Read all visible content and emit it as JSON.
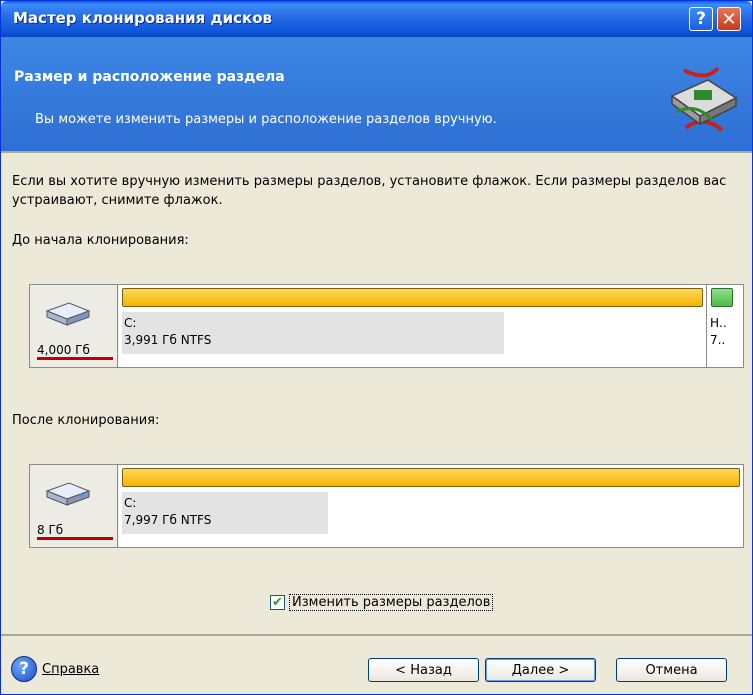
{
  "window": {
    "title": "Мастер клонирования дисков",
    "help_button": "?",
    "close_button": "✕"
  },
  "header": {
    "title": "Размер и расположение раздела",
    "subtitle": "Вы можете изменить размеры и расположение разделов вручную."
  },
  "intro_text": "Если вы хотите вручную изменить размеры разделов, установите флажок. Если размеры разделов вас устраивают, снимите флажок.",
  "before": {
    "label": "До начала клонирования:",
    "disk_size": "4,000 Гб",
    "partition_name": "C:",
    "partition_info": "3,991 Гб  NTFS",
    "used_fraction": 0.65,
    "small_partition_line1": "Н..",
    "small_partition_line2": "7.."
  },
  "after": {
    "label": "После клонирования:",
    "disk_size": "8 Гб",
    "partition_name": "C:",
    "partition_info": "7,997 Гб  NTFS",
    "used_fraction": 0.33
  },
  "checkbox": {
    "label": "Изменить размеры разделов",
    "checked": true
  },
  "footer": {
    "help_label": "Справка",
    "back_label": "< Назад",
    "next_label": "Далее >",
    "cancel_label": "Отмена"
  }
}
